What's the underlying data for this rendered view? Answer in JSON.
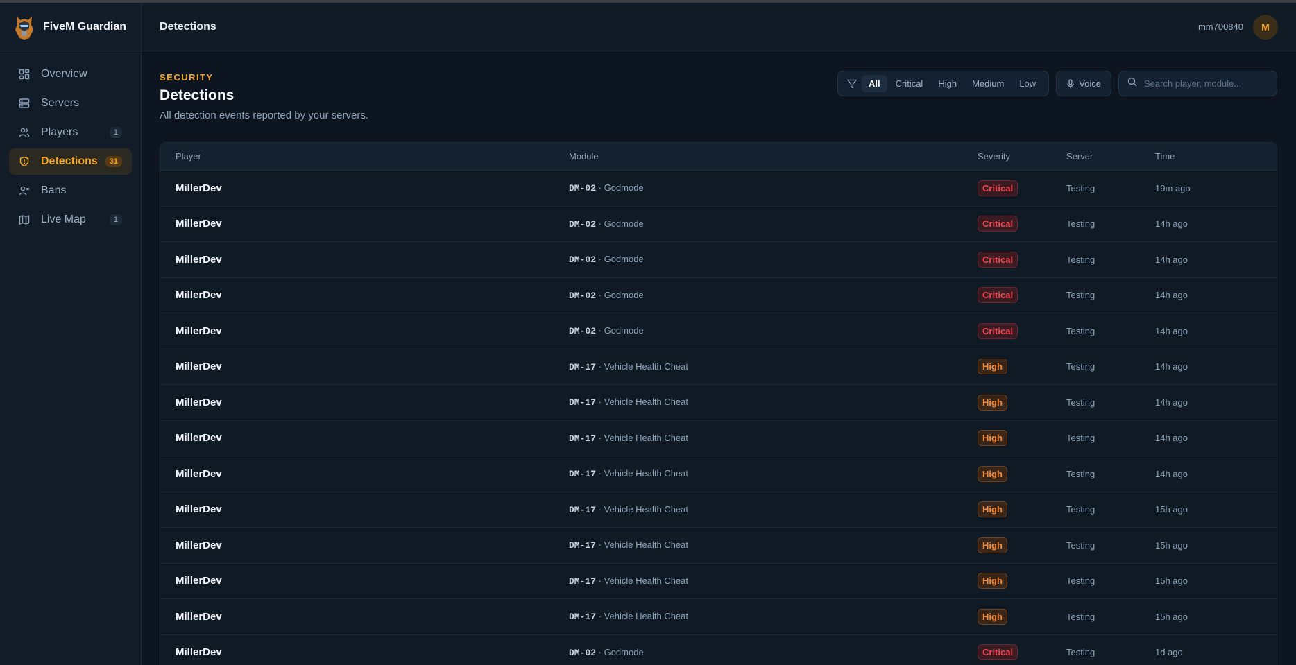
{
  "app": {
    "name": "FiveM Guardian"
  },
  "sidebar": {
    "items": [
      {
        "label": "Overview",
        "icon": "grid-icon",
        "count": null
      },
      {
        "label": "Servers",
        "icon": "server-icon",
        "count": null
      },
      {
        "label": "Players",
        "icon": "users-icon",
        "count": "1"
      },
      {
        "label": "Detections",
        "icon": "shield-icon",
        "count": "31",
        "active": true
      },
      {
        "label": "Bans",
        "icon": "user-x-icon",
        "count": null
      },
      {
        "label": "Live Map",
        "icon": "map-icon",
        "count": "1"
      }
    ]
  },
  "topbar": {
    "title": "Detections",
    "username": "mm700840",
    "avatar_initial": "M"
  },
  "page": {
    "eyebrow": "SECURITY",
    "title": "Detections",
    "subtitle": "All detection events reported by your servers."
  },
  "filters": {
    "options": [
      "All",
      "Critical",
      "High",
      "Medium",
      "Low"
    ],
    "selected": "All",
    "voice_label": "Voice",
    "search_placeholder": "Search player, module..."
  },
  "table": {
    "columns": {
      "player": "Player",
      "module": "Module",
      "severity": "Severity",
      "server": "Server",
      "time": "Time"
    },
    "rows": [
      {
        "player": "MillerDev",
        "code": "DM-02",
        "module": "Godmode",
        "severity": "Critical",
        "server": "Testing",
        "time": "19m ago"
      },
      {
        "player": "MillerDev",
        "code": "DM-02",
        "module": "Godmode",
        "severity": "Critical",
        "server": "Testing",
        "time": "14h ago"
      },
      {
        "player": "MillerDev",
        "code": "DM-02",
        "module": "Godmode",
        "severity": "Critical",
        "server": "Testing",
        "time": "14h ago"
      },
      {
        "player": "MillerDev",
        "code": "DM-02",
        "module": "Godmode",
        "severity": "Critical",
        "server": "Testing",
        "time": "14h ago"
      },
      {
        "player": "MillerDev",
        "code": "DM-02",
        "module": "Godmode",
        "severity": "Critical",
        "server": "Testing",
        "time": "14h ago"
      },
      {
        "player": "MillerDev",
        "code": "DM-17",
        "module": "Vehicle Health Cheat",
        "severity": "High",
        "server": "Testing",
        "time": "14h ago"
      },
      {
        "player": "MillerDev",
        "code": "DM-17",
        "module": "Vehicle Health Cheat",
        "severity": "High",
        "server": "Testing",
        "time": "14h ago"
      },
      {
        "player": "MillerDev",
        "code": "DM-17",
        "module": "Vehicle Health Cheat",
        "severity": "High",
        "server": "Testing",
        "time": "14h ago"
      },
      {
        "player": "MillerDev",
        "code": "DM-17",
        "module": "Vehicle Health Cheat",
        "severity": "High",
        "server": "Testing",
        "time": "14h ago"
      },
      {
        "player": "MillerDev",
        "code": "DM-17",
        "module": "Vehicle Health Cheat",
        "severity": "High",
        "server": "Testing",
        "time": "15h ago"
      },
      {
        "player": "MillerDev",
        "code": "DM-17",
        "module": "Vehicle Health Cheat",
        "severity": "High",
        "server": "Testing",
        "time": "15h ago"
      },
      {
        "player": "MillerDev",
        "code": "DM-17",
        "module": "Vehicle Health Cheat",
        "severity": "High",
        "server": "Testing",
        "time": "15h ago"
      },
      {
        "player": "MillerDev",
        "code": "DM-17",
        "module": "Vehicle Health Cheat",
        "severity": "High",
        "server": "Testing",
        "time": "15h ago"
      },
      {
        "player": "MillerDev",
        "code": "DM-02",
        "module": "Godmode",
        "severity": "Critical",
        "server": "Testing",
        "time": "1d ago"
      }
    ]
  },
  "colors": {
    "accent": "#f5a524",
    "critical": "#f0454f",
    "high": "#f28a3a",
    "background": "#0d1620"
  }
}
